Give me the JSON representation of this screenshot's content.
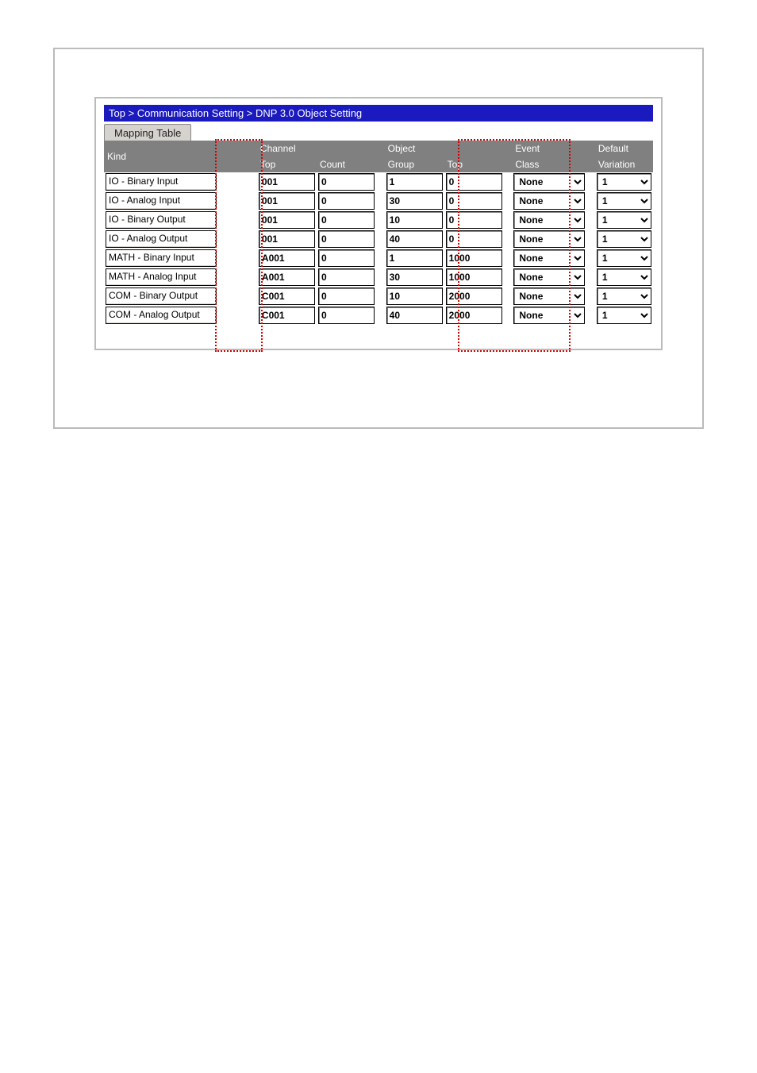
{
  "breadcrumb": "Top > Communication Setting > DNP 3.0 Object Setting",
  "tab_label": "Mapping Table",
  "headers": {
    "kind": "Kind",
    "channel": "Channel",
    "object": "Object",
    "event": "Event",
    "default": "Default",
    "ch_top": "Top",
    "count": "Count",
    "group": "Group",
    "obj_top": "Top",
    "class": "Class",
    "variation": "Variation"
  },
  "rows": [
    {
      "kind": "IO - Binary Input",
      "ch_top": "001",
      "count": "0",
      "group": "1",
      "obj_top": "0",
      "event": "None",
      "variation": "1"
    },
    {
      "kind": "IO - Analog Input",
      "ch_top": "001",
      "count": "0",
      "group": "30",
      "obj_top": "0",
      "event": "None",
      "variation": "1"
    },
    {
      "kind": "IO - Binary Output",
      "ch_top": "001",
      "count": "0",
      "group": "10",
      "obj_top": "0",
      "event": "None",
      "variation": "1"
    },
    {
      "kind": "IO - Analog Output",
      "ch_top": "001",
      "count": "0",
      "group": "40",
      "obj_top": "0",
      "event": "None",
      "variation": "1"
    },
    {
      "kind": "MATH - Binary Input",
      "ch_top": "A001",
      "count": "0",
      "group": "1",
      "obj_top": "1000",
      "event": "None",
      "variation": "1"
    },
    {
      "kind": "MATH - Analog Input",
      "ch_top": "A001",
      "count": "0",
      "group": "30",
      "obj_top": "1000",
      "event": "None",
      "variation": "1"
    },
    {
      "kind": "COM - Binary Output",
      "ch_top": "C001",
      "count": "0",
      "group": "10",
      "obj_top": "2000",
      "event": "None",
      "variation": "1"
    },
    {
      "kind": "COM - Analog Output",
      "ch_top": "C001",
      "count": "0",
      "group": "40",
      "obj_top": "2000",
      "event": "None",
      "variation": "1"
    }
  ]
}
